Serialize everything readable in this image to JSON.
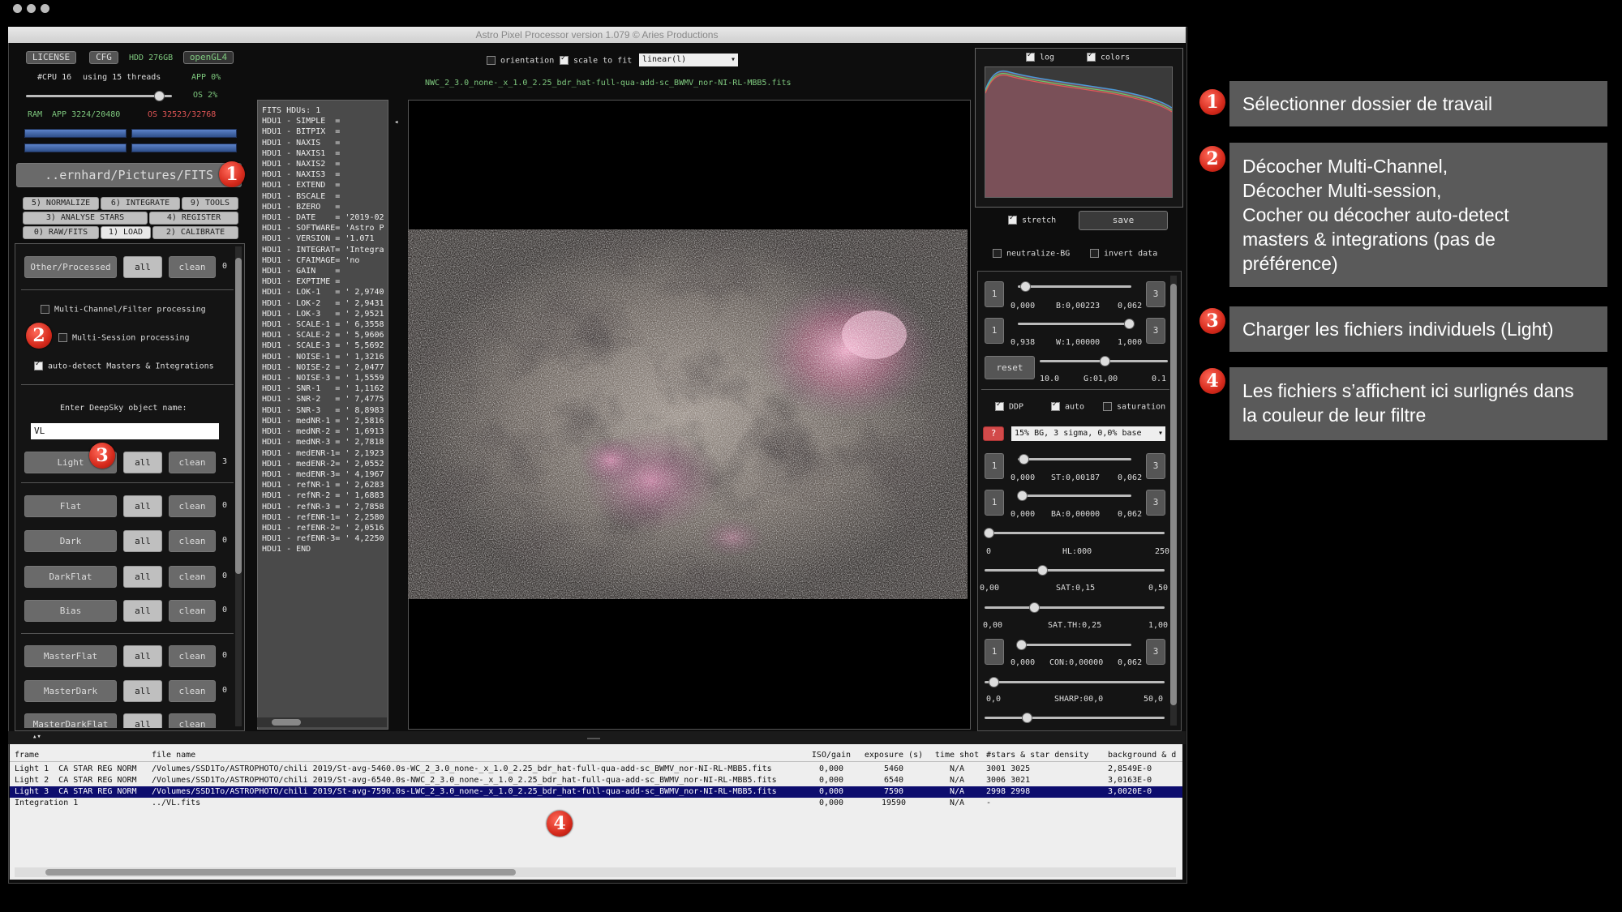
{
  "window": {
    "title": "Astro Pixel Processor version 1.079 © Aries Productions"
  },
  "topbar": {
    "license": "LICENSE",
    "cfg": "CFG",
    "hdd": "HDD 276GB",
    "opengl": "openGL4",
    "cpu": "#CPU 16",
    "threads": "using 15 threads",
    "app_pct": "APP 0%",
    "os_pct": "OS 2%",
    "ram_label": "RAM",
    "ram_app": "APP 3224/20480",
    "ram_os": "OS 32523/32768",
    "folder": "..ernhard/Pictures/FITS"
  },
  "tabs": {
    "row1": [
      "5) NORMALIZE",
      "6) INTEGRATE",
      "9) TOOLS"
    ],
    "row2": [
      "3) ANALYSE STARS",
      "4) REGISTER"
    ],
    "row3": [
      "0) RAW/FITS",
      "1) LOAD",
      "2) CALIBRATE"
    ]
  },
  "load_panel": {
    "other": {
      "label": "Other/Processed",
      "all": "all",
      "clean": "clean",
      "count": "0"
    },
    "multichannel": "Multi-Channel/Filter processing",
    "multisession": "Multi-Session processing",
    "autodetect": "auto-detect Masters & Integrations",
    "object_label": "Enter DeepSky object name:",
    "object_value": "VL",
    "frames": [
      {
        "label": "Light",
        "all": "all",
        "clean": "clean",
        "count": "3"
      },
      {
        "label": "Flat",
        "all": "all",
        "clean": "clean",
        "count": "0"
      },
      {
        "label": "Dark",
        "all": "all",
        "clean": "clean",
        "count": "0"
      },
      {
        "label": "DarkFlat",
        "all": "all",
        "clean": "clean",
        "count": "0"
      },
      {
        "label": "Bias",
        "all": "all",
        "clean": "clean",
        "count": "0"
      },
      {
        "label": "MasterFlat",
        "all": "all",
        "clean": "clean",
        "count": "0"
      },
      {
        "label": "MasterDark",
        "all": "all",
        "clean": "clean",
        "count": "0"
      },
      {
        "label": "MasterDarkFlat",
        "all": "all",
        "clean": "clean",
        "count": "0"
      }
    ]
  },
  "viewer": {
    "orientation": "orientation",
    "scale": "scale to fit",
    "stretch_mode": "linear(l)",
    "filename": "NWC_2_3.0_none-_x_1.0_2.25_bdr_hat-full-qua-add-sc_BWMV_nor-NI-RL-MBB5.fits"
  },
  "header_lines": [
    "FITS HDUs: 1",
    "HDU1 - SIMPLE  =",
    "HDU1 - BITPIX  =",
    "HDU1 - NAXIS   =",
    "HDU1 - NAXIS1  =",
    "HDU1 - NAXIS2  =",
    "HDU1 - NAXIS3  =",
    "HDU1 - EXTEND  =",
    "HDU1 - BSCALE  =",
    "HDU1 - BZERO   =",
    "HDU1 - DATE    = '2019-02",
    "HDU1 - SOFTWARE= 'Astro P",
    "HDU1 - VERSION = '1.071",
    "HDU1 - INTEGRAT= 'Integra",
    "HDU1 - CFAIMAGE= 'no",
    "HDU1 - GAIN    =",
    "HDU1 - EXPTIME =",
    "HDU1 - LOK-1   = ' 2,9740",
    "HDU1 - LOK-2   = ' 2,9431",
    "HDU1 - LOK-3   = ' 2,9521",
    "HDU1 - SCALE-1 = ' 6,3558",
    "HDU1 - SCALE-2 = ' 5,9606",
    "HDU1 - SCALE-3 = ' 5,5692",
    "HDU1 - NOISE-1 = ' 1,3216",
    "HDU1 - NOISE-2 = ' 2,0477",
    "HDU1 - NOISE-3 = ' 1,5559",
    "HDU1 - SNR-1   = ' 1,1162",
    "HDU1 - SNR-2   = ' 7,4775",
    "HDU1 - SNR-3   = ' 8,8983",
    "HDU1 - medNR-1 = ' 2,5816",
    "HDU1 - medNR-2 = ' 1,6913",
    "HDU1 - medNR-3 = ' 2,7818",
    "HDU1 - medENR-1= ' 2,1923",
    "HDU1 - medENR-2= ' 2,0552",
    "HDU1 - medENR-3= ' 4,1967",
    "HDU1 - refNR-1 = ' 2,6283",
    "HDU1 - refNR-2 = ' 1,6883",
    "HDU1 - refNR-3 = ' 2,7858",
    "HDU1 - refENR-1= ' 2,2580",
    "HDU1 - refENR-2= ' 2,0516",
    "HDU1 - refENR-3= ' 4,2250",
    "HDU1 - END"
  ],
  "right_panel": {
    "log": "log",
    "colors": "colors",
    "stretch": "stretch",
    "save": "save",
    "neutralize": "neutralize-BG",
    "invert": "invert data",
    "b_min": "0,000",
    "b_label": "B:0,00223",
    "b_max": "0,062",
    "w_min": "0,938",
    "w_label": "W:1,00000",
    "w_max": "1,000",
    "reset": "reset",
    "g_min": "10.0",
    "g_label": "G:01,00",
    "g_max": "0.1",
    "ddp": "DDP",
    "auto": "auto",
    "saturation": "saturation",
    "q": "?",
    "bg_mode": "15% BG, 3 sigma, 0,0% base",
    "st_min": "0,000",
    "st_label": "ST:0,00187",
    "st_max": "0,062",
    "ba_min": "0,000",
    "ba_label": "BA:0,00000",
    "ba_max": "0,062",
    "hl_min": "0",
    "hl_label": "HL:000",
    "hl_max": "250",
    "sat_min": "0,00",
    "sat_label": "SAT:0,15",
    "sat_max": "0,50",
    "satth_min": "0,00",
    "satth_label": "SAT.TH:0,25",
    "satth_max": "1,00",
    "con_min": "0,000",
    "con_label": "CON:0,00000",
    "con_max": "0,062",
    "sharp_min": "0,0",
    "sharp_label": "SHARP:00,0",
    "sharp_max": "50,0",
    "one": "1",
    "three": "3"
  },
  "filelist": {
    "columns": [
      "frame",
      "file name",
      "ISO/gain",
      "exposure (s)",
      "time shot",
      "#stars & star density",
      "background & d"
    ],
    "rows": [
      [
        "Light 1  CA STAR REG NORM",
        "/Volumes/SSD1To/ASTROPHOTO/chili 2019/St-avg-5460.0s-WC_2_3.0_none-_x_1.0_2.25_bdr_hat-full-qua-add-sc_BWMV_nor-NI-RL-MBB5.fits",
        "0,000",
        "5460",
        "N/A",
        "3001 3025",
        "2,8549E-0"
      ],
      [
        "Light 2  CA STAR REG NORM",
        "/Volumes/SSD1To/ASTROPHOTO/chili 2019/St-avg-6540.0s-NWC_2_3.0_none-_x_1.0_2.25_bdr_hat-full-qua-add-sc_BWMV_nor-NI-RL-MBB5.fits",
        "0,000",
        "6540",
        "N/A",
        "3006 3021",
        "3,0163E-0"
      ],
      [
        "Light 3  CA STAR REG NORM",
        "/Volumes/SSD1To/ASTROPHOTO/chili 2019/St-avg-7590.0s-LWC_2_3.0_none-_x_1.0_2.25_bdr_hat-full-qua-add-sc_BWMV_nor-NI-RL-MBB5.fits",
        "0,000",
        "7590",
        "N/A",
        "2998 2998",
        "3,0020E-0"
      ],
      [
        "Integration 1",
        "../VL.fits",
        "0,000",
        "19590",
        "N/A",
        "-",
        ""
      ]
    ]
  },
  "callouts": [
    {
      "num": "1",
      "text": "Sélectionner dossier de travail"
    },
    {
      "num": "2",
      "lines": [
        "Décocher Multi-Channel,",
        "Décocher Multi-session,",
        "Cocher ou décocher auto-detect",
        "masters & integrations (pas de",
        "préférence)"
      ]
    },
    {
      "num": "3",
      "text": "Charger les fichiers individuels (Light)"
    },
    {
      "num": "4",
      "lines": [
        "Les fichiers s’affichent ici surlignés dans",
        "la couleur de leur filtre"
      ]
    }
  ],
  "colors": {
    "selected_row": "#0d0d6e",
    "accent_green": "#7ec87e",
    "accent_red": "#e05555",
    "badge": "#d52a1c"
  }
}
